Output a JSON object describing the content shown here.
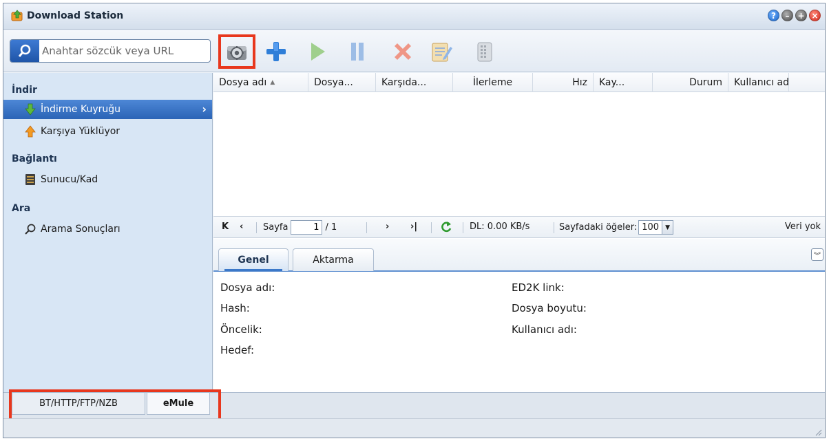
{
  "window": {
    "title": "Download Station"
  },
  "search": {
    "placeholder": "Anahtar sözcük veya URL"
  },
  "sidebar": {
    "sections": [
      {
        "title": "İndir",
        "items": [
          "İndirme Kuyruğu",
          "Karşıya Yüklüyor"
        ]
      },
      {
        "title": "Bağlantı",
        "items": [
          "Sunucu/Kad"
        ]
      },
      {
        "title": "Ara",
        "items": [
          "Arama Sonuçları"
        ]
      }
    ]
  },
  "columns": [
    "Dosya adı",
    "Dosya...",
    "Karşıda...",
    "İlerleme",
    "Hız",
    "Kay...",
    "Durum",
    "Kullanıcı adı"
  ],
  "pager": {
    "page_label": "Sayfa",
    "page_value": "1",
    "page_total": "/ 1",
    "dl_text": "DL: 0.00 KB/s",
    "per_page_label": "Sayfadaki öğeler:",
    "per_page_value": "100",
    "no_data": "Veri yok"
  },
  "detail_tabs": [
    "Genel",
    "Aktarma"
  ],
  "detail_fields": {
    "left": [
      "Dosya adı:",
      "Hash:",
      "Öncelik:",
      "Hedef:"
    ],
    "right": [
      "ED2K link:",
      "Dosya boyutu:",
      "Kullanıcı adı:"
    ]
  },
  "bottom_tabs": [
    "BT/HTTP/FTP/NZB",
    "eMule"
  ],
  "colors": {
    "highlight": "#e8371d",
    "selected": "#2b64b6",
    "sidebar_bg": "#d8e6f5"
  }
}
